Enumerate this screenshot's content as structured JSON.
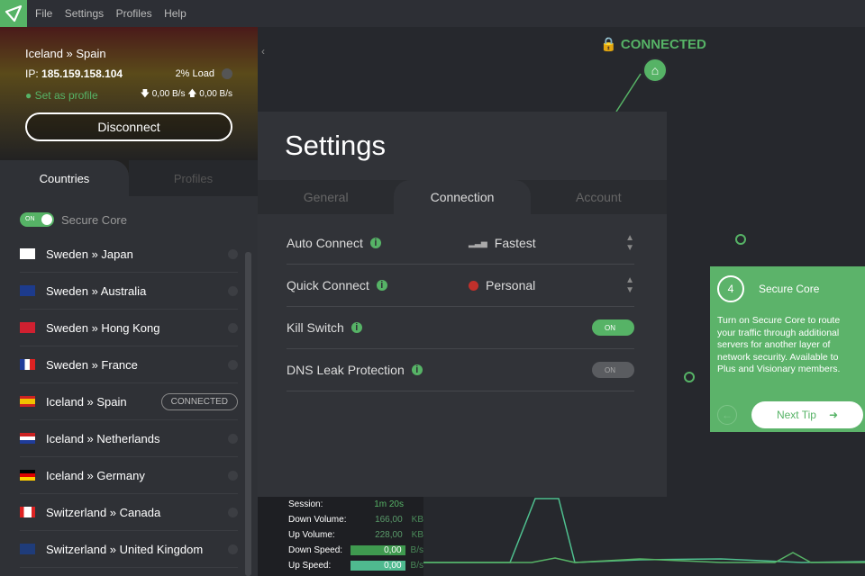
{
  "menu": {
    "items": [
      "File",
      "Settings",
      "Profiles",
      "Help"
    ]
  },
  "header": {
    "route": "Iceland » Spain",
    "ip_label": "IP:",
    "ip": "185.159.158.104",
    "load": "2% Load",
    "set_profile": "Set as profile",
    "down": "0,00 B/s",
    "up": "0,00 B/s",
    "disconnect": "Disconnect"
  },
  "left_tabs": [
    "Countries",
    "Profiles"
  ],
  "secure_core": {
    "toggle": "ON",
    "label": "Secure Core"
  },
  "servers": [
    {
      "name": "Sweden » Japan",
      "flag": "JP"
    },
    {
      "name": "Sweden » Australia",
      "flag": "AU"
    },
    {
      "name": "Sweden » Hong Kong",
      "flag": "HK"
    },
    {
      "name": "Sweden » France",
      "flag": "FR"
    },
    {
      "name": "Iceland » Spain",
      "flag": "ES",
      "badge": "CONNECTED"
    },
    {
      "name": "Iceland » Netherlands",
      "flag": "NL"
    },
    {
      "name": "Iceland » Germany",
      "flag": "DE"
    },
    {
      "name": "Switzerland » Canada",
      "flag": "CA"
    },
    {
      "name": "Switzerland » United Kingdom",
      "flag": "GB"
    }
  ],
  "map": {
    "status": "CONNECTED"
  },
  "settings": {
    "title": "Settings",
    "tabs": [
      "General",
      "Connection",
      "Account"
    ],
    "rows": [
      {
        "label": "Auto Connect",
        "value": "Fastest"
      },
      {
        "label": "Quick Connect",
        "value": "Personal"
      },
      {
        "label": "Kill Switch",
        "toggle": "ON"
      },
      {
        "label": "DNS Leak Protection",
        "toggle": "ON"
      }
    ]
  },
  "stats": [
    {
      "k": "Session:",
      "v": "1m 20s",
      "u": ""
    },
    {
      "k": "Down Volume:",
      "v": "166,00",
      "u": "KB"
    },
    {
      "k": "Up Volume:",
      "v": "228,00",
      "u": "KB"
    },
    {
      "k": "Down Speed:",
      "v": "0,00",
      "u": "B/s"
    },
    {
      "k": "Up Speed:",
      "v": "0,00",
      "u": "B/s"
    }
  ],
  "tip": {
    "number": "4",
    "title": "Secure Core",
    "text": "Turn on Secure Core to route your traffic through additional servers for another layer of network security. Available to Plus and Visionary members.",
    "next": "Next Tip"
  },
  "colors": {
    "accent": "#56b366"
  }
}
